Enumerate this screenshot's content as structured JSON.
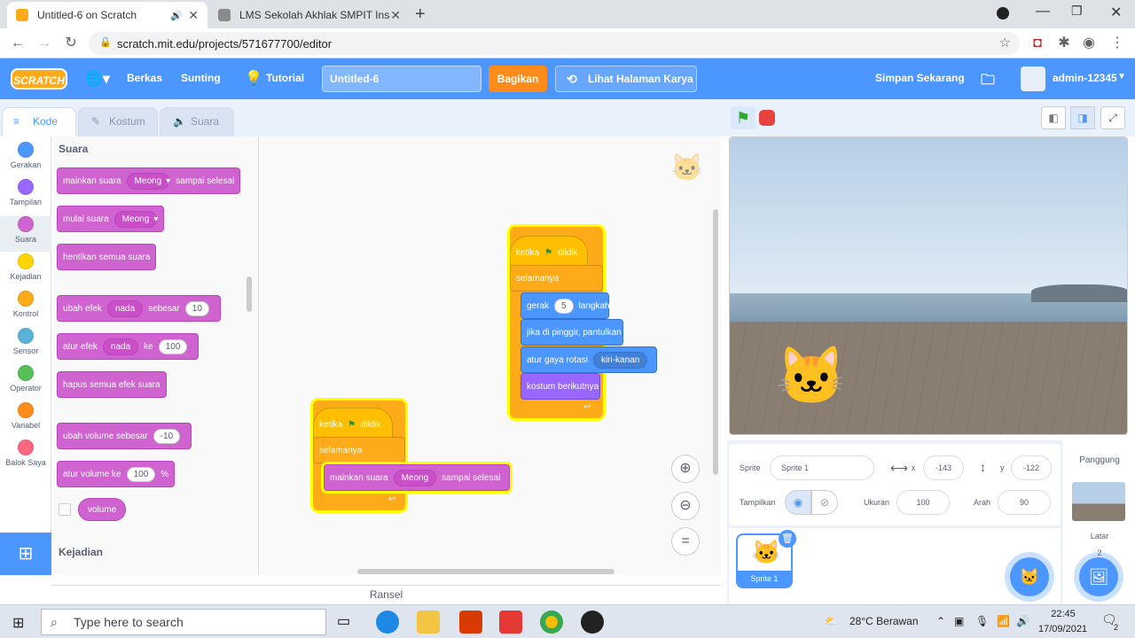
{
  "browser": {
    "tabs": [
      {
        "title": "Untitled-6 on Scratch"
      },
      {
        "title": "LMS Sekolah Akhlak SMPIT Insan"
      }
    ],
    "url": "scratch.mit.edu/projects/571677700/editor"
  },
  "menu": {
    "logo": "SCRATCH",
    "file": "Berkas",
    "edit": "Sunting",
    "tutorial": "Tutorial",
    "project_title": "Untitled-6",
    "share": "Bagikan",
    "see_project": "Lihat Halaman Karya",
    "save_now": "Simpan Sekarang",
    "username": "admin-12345"
  },
  "tabs": {
    "code": "Kode",
    "costumes": "Kostum",
    "sounds": "Suara"
  },
  "categories": [
    {
      "label": "Gerakan",
      "color": "#4c97ff"
    },
    {
      "label": "Tampilan",
      "color": "#9966ff"
    },
    {
      "label": "Suara",
      "color": "#cf63cf"
    },
    {
      "label": "Kejadian",
      "color": "#ffd500"
    },
    {
      "label": "Kontrol",
      "color": "#ffab19"
    },
    {
      "label": "Sensor",
      "color": "#5cb1d6"
    },
    {
      "label": "Operator",
      "color": "#59c059"
    },
    {
      "label": "Variabel",
      "color": "#ff8c1a"
    },
    {
      "label": "Balok Saya",
      "color": "#ff6680"
    }
  ],
  "palette": {
    "section_sound": "Suara",
    "section_events": "Kejadian",
    "play_until": {
      "a": "mainkan suara",
      "dd": "Meong",
      "b": "sampai selesai"
    },
    "start_sound": {
      "a": "mulai suara",
      "dd": "Meong"
    },
    "stop_all": "hentikan semua suara",
    "change_effect": {
      "a": "ubah efek",
      "dd": "nada",
      "b": "sebesar",
      "n": "10"
    },
    "set_effect": {
      "a": "atur efek",
      "dd": "nada",
      "b": "ke",
      "n": "100"
    },
    "clear_effects": "hapus semua efek suara",
    "change_volume": {
      "a": "ubah volume sebesar",
      "n": "-10"
    },
    "set_volume": {
      "a": "atur volume ke",
      "n": "100",
      "b": "%"
    },
    "volume": "volume"
  },
  "script1": {
    "hat_a": "ketika",
    "hat_b": "diklik",
    "forever": "selamanya",
    "move_a": "gerak",
    "move_n": "5",
    "move_b": "langkah",
    "bounce": "jika di pinggir, pantulkan",
    "rotation_a": "atur gaya rotasi",
    "rotation_dd": "kiri-kanan",
    "next_costume": "kostum berikutnya"
  },
  "script2": {
    "hat_a": "ketika",
    "hat_b": "diklik",
    "forever": "selamanya",
    "play_a": "mainkan suara",
    "play_dd": "Meong",
    "play_b": "sampai selesai"
  },
  "backpack": "Ransel",
  "sprite_info": {
    "sprite_label": "Sprite",
    "sprite_name": "Sprite 1",
    "x_label": "x",
    "x_value": "-143",
    "y_label": "y",
    "y_value": "-122",
    "show_label": "Tampilkan",
    "size_label": "Ukuran",
    "size_value": "100",
    "direction_label": "Arah",
    "direction_value": "90"
  },
  "sprite_thumb": "Sprite 1",
  "stage_panel": {
    "title": "Panggung",
    "backdrops_label": "Latar",
    "backdrops_count": "2"
  },
  "taskbar": {
    "search_placeholder": "Type here to search",
    "weather": "28°C  Berawan",
    "time": "22:45",
    "date": "17/09/2021",
    "notifications": "2"
  }
}
